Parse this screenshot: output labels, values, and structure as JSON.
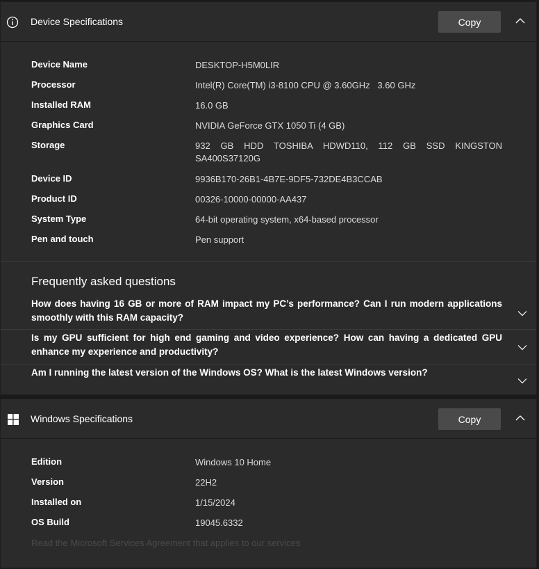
{
  "device_section": {
    "title": "Device Specifications",
    "copy_label": "Copy",
    "specs": [
      {
        "label": "Device Name",
        "value": "DESKTOP-H5M0LIR"
      },
      {
        "label": "Processor",
        "value": "Intel(R) Core(TM) i3-8100 CPU @ 3.60GHz   3.60 GHz"
      },
      {
        "label": "Installed RAM",
        "value": "16.0 GB"
      },
      {
        "label": "Graphics Card",
        "value": "NVIDIA GeForce GTX 1050 Ti (4 GB)"
      },
      {
        "label": "Storage",
        "value": "932 GB HDD TOSHIBA HDWD110, 112 GB SSD KINGSTON SA400S37120G"
      },
      {
        "label": "Device ID",
        "value": "9936B170-26B1-4B7E-9DF5-732DE4B3CCAB"
      },
      {
        "label": "Product ID",
        "value": "00326-10000-00000-AA437"
      },
      {
        "label": "System Type",
        "value": "64-bit operating system, x64-based processor"
      },
      {
        "label": "Pen and touch",
        "value": "Pen support"
      }
    ]
  },
  "faq": {
    "title": "Frequently asked questions",
    "questions": [
      "How does having 16 GB or more of RAM impact my PC’s performance? Can I run modern applications smoothly with this RAM capacity?",
      "Is my GPU sufficient for high end gaming and video experience? How can having a dedicated GPU enhance my experience and productivity?",
      "Am I running the latest version of the Windows OS? What is the latest Windows version?"
    ]
  },
  "windows_section": {
    "title": "Windows Specifications",
    "copy_label": "Copy",
    "specs": [
      {
        "label": "Edition",
        "value": "Windows 10 Home"
      },
      {
        "label": "Version",
        "value": "22H2"
      },
      {
        "label": "Installed on",
        "value": "1/15/2024"
      },
      {
        "label": "OS Build",
        "value": "19045.6332"
      }
    ],
    "footer_link": "Read the Microsoft Services Agreement that applies to our services"
  },
  "icons": {
    "device_header": "info-icon",
    "windows_header": "windows-logo-icon",
    "collapse": "chevron-up-icon",
    "expand": "chevron-down-icon"
  },
  "colors": {
    "panel": "#2b2b2b",
    "button": "#4a4a4a",
    "muted_link": "#4a4a4a"
  }
}
